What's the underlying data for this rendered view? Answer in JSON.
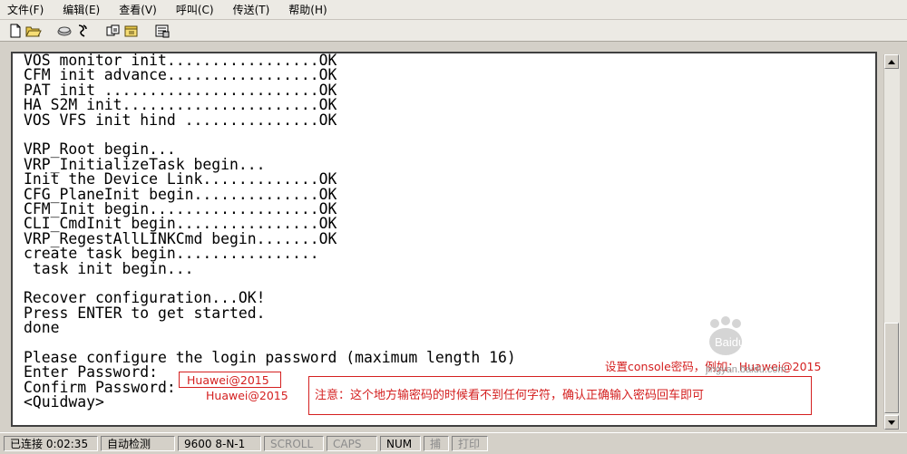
{
  "menu": [
    "文件(F)",
    "编辑(E)",
    "查看(V)",
    "呼叫(C)",
    "传送(T)",
    "帮助(H)"
  ],
  "toolbar_icons": [
    "new-icon",
    "open-icon",
    "disconnect-icon",
    "dial-icon",
    "properties-icon",
    "send-file-icon",
    "receive-icon",
    "settings-icon"
  ],
  "console": {
    "lines": [
      "VOS monitor init.................OK",
      "CFM init advance.................OK",
      "PAT init ........................OK",
      "HA S2M init......................OK",
      "VOS VFS init hind ...............OK",
      "",
      "VRP_Root begin...",
      "VRP_InitializeTask begin...",
      "Init the Device Link.............OK",
      "CFG_PlaneInit begin..............OK",
      "CFM_Init begin...................OK",
      "CLI_CmdInit begin................OK",
      "VRP_RegestAllLINKCmd begin.......OK",
      "create task begin................",
      " task init begin...",
      "",
      "Recover configuration...OK!",
      "Press ENTER to get started.",
      "done",
      "",
      "Please configure the login password (maximum length 16)",
      "Enter Password:",
      "Confirm Password:",
      "<Quidway>"
    ]
  },
  "annotations": {
    "setup_hint": "设置console密码，例如：Huawei@2015",
    "enter_value": "Huawei@2015",
    "confirm_value": "Huawei@2015",
    "note": "注意：这个地方输密码的时候看不到任何字符，确认正确输入密码回车即可"
  },
  "watermark": {
    "logo": "Baidu经验",
    "url": "jingyan.baidu.com"
  },
  "status": {
    "connection": "已连接 0:02:35",
    "detect": "自动检测",
    "baud": "9600 8-N-1",
    "scroll": "SCROLL",
    "caps": "CAPS",
    "num": "NUM",
    "capture": "捕",
    "print": "打印"
  }
}
